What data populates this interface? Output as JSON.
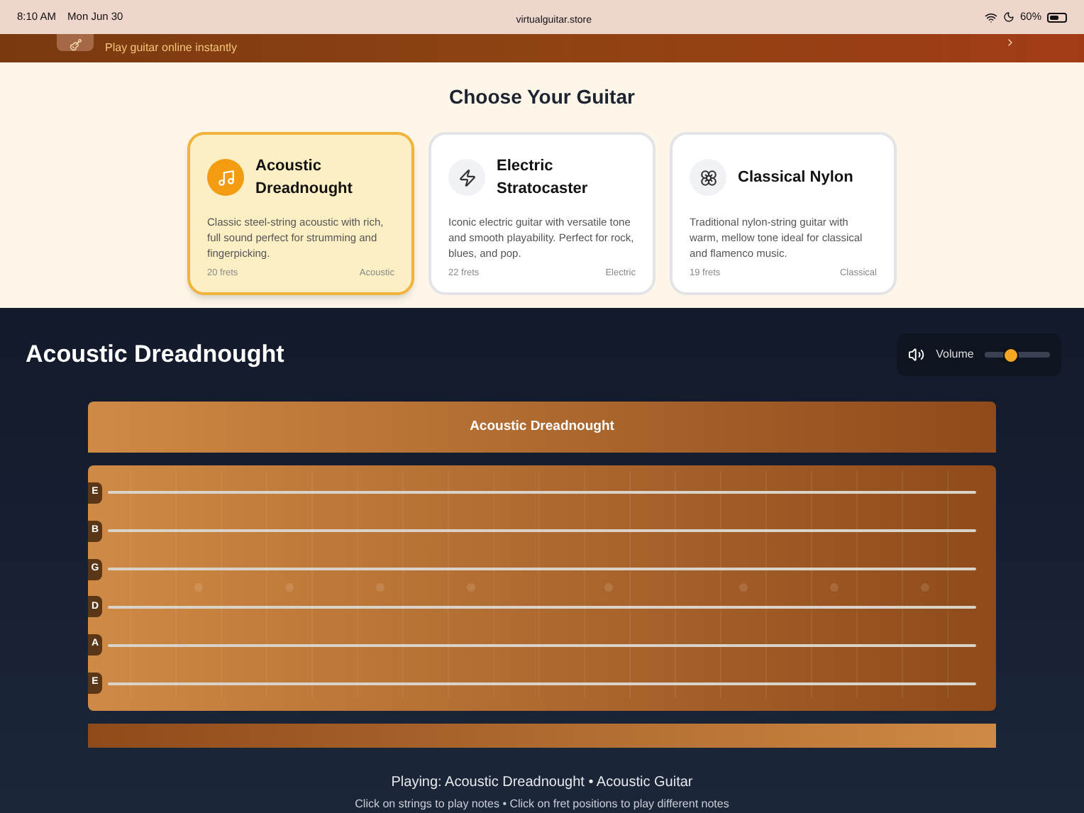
{
  "status_bar": {
    "time": "8:10 AM",
    "date": "Mon Jun 30",
    "url": "virtualguitar.store",
    "battery": "60%"
  },
  "header": {
    "tagline": "Play guitar online instantly"
  },
  "picker": {
    "title": "Choose Your Guitar",
    "cards": [
      {
        "name": "Acoustic Dreadnought",
        "kind": "acoustic",
        "selected": true,
        "description": "Classic steel-string acoustic with rich, full sound perfect for strumming and fingerpicking.",
        "frets": "20 frets",
        "type": "Acoustic"
      },
      {
        "name": "Electric Stratocaster",
        "kind": "electric",
        "selected": false,
        "description": "Iconic electric guitar with versatile tone and smooth playability. Perfect for rock, blues, and pop.",
        "frets": "22 frets",
        "type": "Electric"
      },
      {
        "name": "Classical Nylon",
        "kind": "classical",
        "selected": false,
        "description": "Traditional nylon-string guitar with warm, mellow tone ideal for classical and flamenco music.",
        "frets": "19 frets",
        "type": "Classical"
      }
    ]
  },
  "player": {
    "title": "Acoustic Dreadnought",
    "volume": {
      "label": "Volume",
      "level": 0.38
    },
    "headstock": "Acoustic Dreadnought",
    "strings": [
      "E",
      "B",
      "G",
      "D",
      "A",
      "E"
    ],
    "now_playing": "Playing: Acoustic Dreadnought • Acoustic Guitar",
    "hint": "Click on strings to play notes • Click on fret positions to play different notes"
  }
}
